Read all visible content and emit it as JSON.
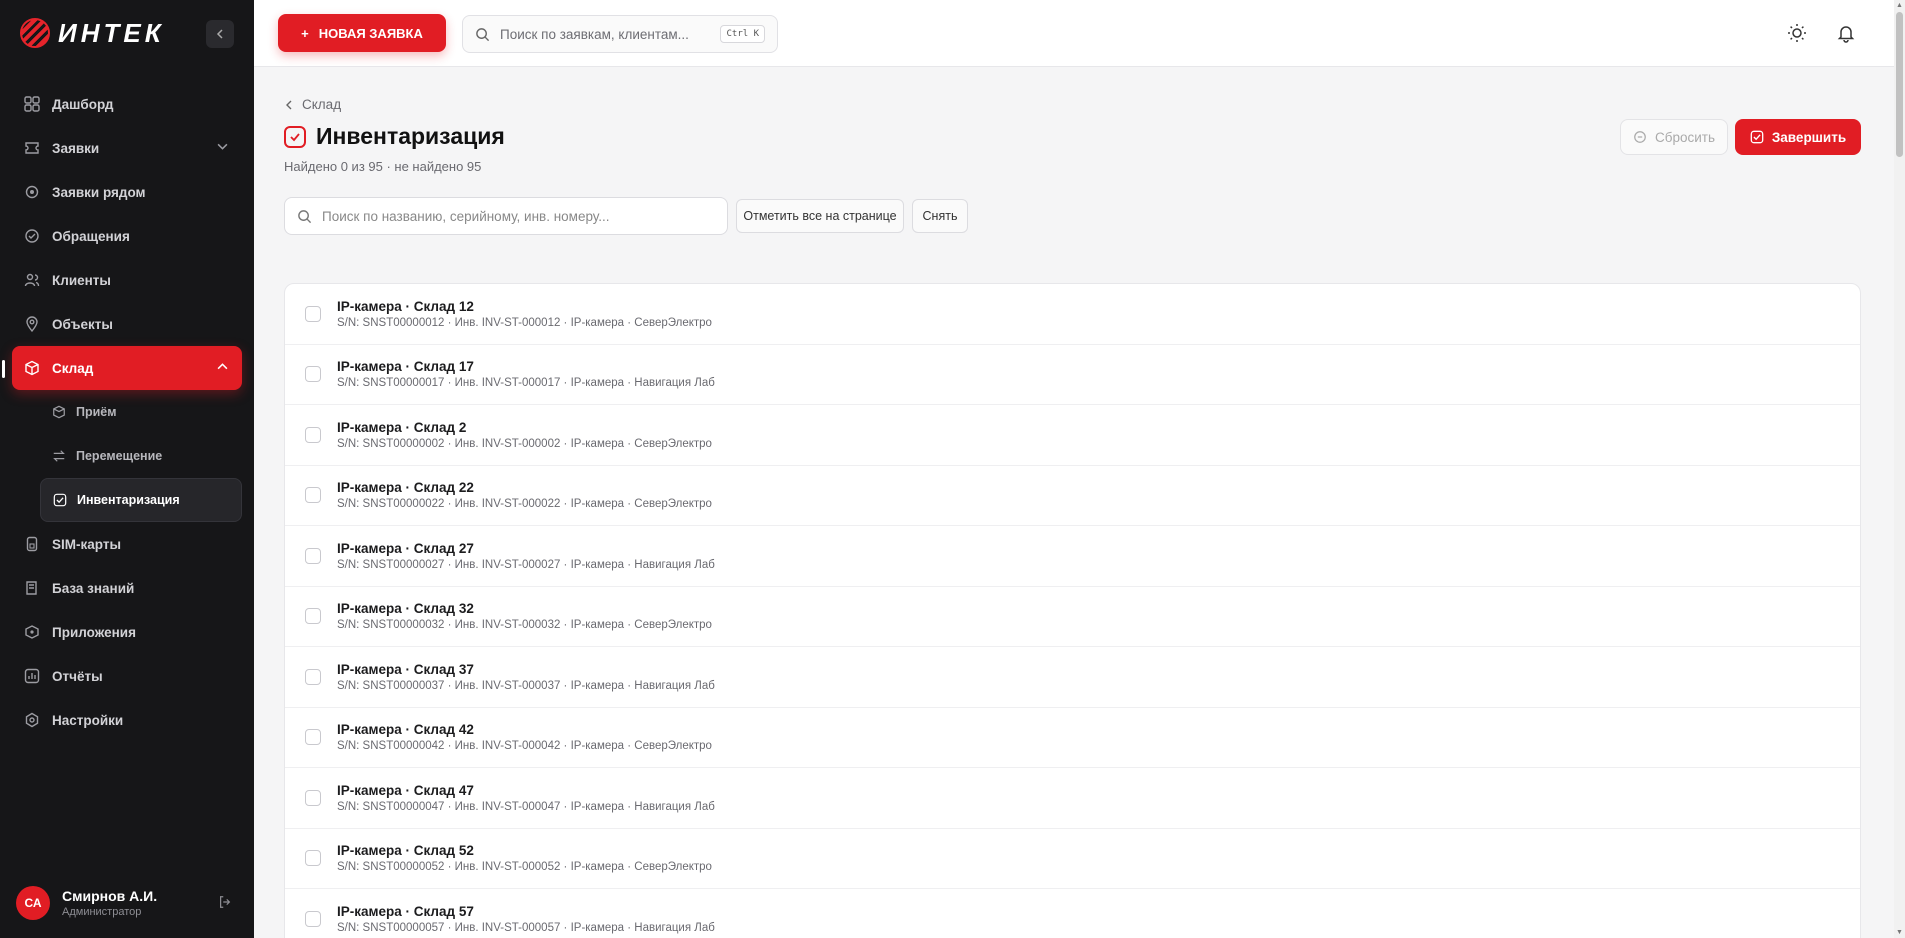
{
  "brand": {
    "name": "ИНТЕК"
  },
  "sidebar": {
    "collapse_icon": "chevron-left-icon",
    "items": [
      {
        "label": "Дашборд",
        "icon": "dashboard-icon"
      },
      {
        "label": "Заявки",
        "icon": "tickets-icon",
        "expandable": true
      },
      {
        "label": "Заявки рядом",
        "icon": "nearby-icon"
      },
      {
        "label": "Обращения",
        "icon": "inbox-icon"
      },
      {
        "label": "Клиенты",
        "icon": "users-icon"
      },
      {
        "label": "Объекты",
        "icon": "location-icon"
      },
      {
        "label": "Склад",
        "icon": "box-icon",
        "active": true,
        "expanded": true
      },
      {
        "label": "SIM-карты",
        "icon": "sim-icon"
      },
      {
        "label": "База знаний",
        "icon": "book-icon"
      },
      {
        "label": "Приложения",
        "icon": "apps-icon"
      },
      {
        "label": "Отчёты",
        "icon": "reports-icon"
      },
      {
        "label": "Настройки",
        "icon": "settings-icon"
      }
    ],
    "sub_items": [
      {
        "label": "Приём",
        "icon": "receive-icon"
      },
      {
        "label": "Перемещение",
        "icon": "transfer-icon"
      },
      {
        "label": "Инвентаризация",
        "icon": "inventory-icon",
        "current": true
      }
    ]
  },
  "user": {
    "initials": "СА",
    "name": "Смирнов А.И.",
    "role": "Администратор"
  },
  "topbar": {
    "new_button": "НОВАЯ ЗАЯВКА",
    "search_placeholder": "Поиск по заявкам, клиентам...",
    "shortcut": "Ctrl K"
  },
  "page": {
    "breadcrumb": "Склад",
    "title": "Инвентаризация",
    "summary": "Найдено 0 из 95 · не найдено 95",
    "reset_button": "Сбросить",
    "finish_button": "Завершить",
    "search_placeholder": "Поиск по названию, серийному, инв. номеру...",
    "mark_all_button": "Отметить все на странице",
    "clear_button": "Снять"
  },
  "items": [
    {
      "name": "IP-камера · Склад 12",
      "meta": "S/N: SNST00000012 · Инв. INV-ST-000012 · IP-камера · СеверЭлектро"
    },
    {
      "name": "IP-камера · Склад 17",
      "meta": "S/N: SNST00000017 · Инв. INV-ST-000017 · IP-камера · Навигация Лаб"
    },
    {
      "name": "IP-камера · Склад 2",
      "meta": "S/N: SNST00000002 · Инв. INV-ST-000002 · IP-камера · СеверЭлектро"
    },
    {
      "name": "IP-камера · Склад 22",
      "meta": "S/N: SNST00000022 · Инв. INV-ST-000022 · IP-камера · СеверЭлектро"
    },
    {
      "name": "IP-камера · Склад 27",
      "meta": "S/N: SNST00000027 · Инв. INV-ST-000027 · IP-камера · Навигация Лаб"
    },
    {
      "name": "IP-камера · Склад 32",
      "meta": "S/N: SNST00000032 · Инв. INV-ST-000032 · IP-камера · СеверЭлектро"
    },
    {
      "name": "IP-камера · Склад 37",
      "meta": "S/N: SNST00000037 · Инв. INV-ST-000037 · IP-камера · Навигация Лаб"
    },
    {
      "name": "IP-камера · Склад 42",
      "meta": "S/N: SNST00000042 · Инв. INV-ST-000042 · IP-камера · СеверЭлектро"
    },
    {
      "name": "IP-камера · Склад 47",
      "meta": "S/N: SNST00000047 · Инв. INV-ST-000047 · IP-камера · Навигация Лаб"
    },
    {
      "name": "IP-камера · Склад 52",
      "meta": "S/N: SNST00000052 · Инв. INV-ST-000052 · IP-камера · СеверЭлектро"
    },
    {
      "name": "IP-камера · Склад 57",
      "meta": "S/N: SNST00000057 · Инв. INV-ST-000057 · IP-камера · Навигация Лаб"
    }
  ],
  "colors": {
    "accent": "#e11d24",
    "sidebar_bg": "#161618",
    "page_bg": "#f5f5f6"
  }
}
